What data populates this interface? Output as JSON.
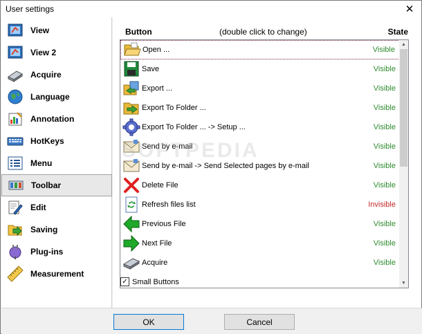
{
  "window": {
    "title": "User settings",
    "close_glyph": "✕"
  },
  "sidebar": {
    "items": [
      {
        "label": "View",
        "icon": "view-icon"
      },
      {
        "label": "View 2",
        "icon": "view2-icon"
      },
      {
        "label": "Acquire",
        "icon": "scanner-icon"
      },
      {
        "label": "Language",
        "icon": "globe-icon"
      },
      {
        "label": "Annotation",
        "icon": "annotation-icon"
      },
      {
        "label": "HotKeys",
        "icon": "keyboard-icon"
      },
      {
        "label": "Menu",
        "icon": "menu-icon"
      },
      {
        "label": "Toolbar",
        "icon": "toolbar-icon",
        "selected": true
      },
      {
        "label": "Edit",
        "icon": "edit-icon"
      },
      {
        "label": "Saving",
        "icon": "saving-icon"
      },
      {
        "label": "Plug-ins",
        "icon": "plugin-icon"
      },
      {
        "label": "Measurement",
        "icon": "ruler-icon"
      }
    ]
  },
  "toolbar_panel": {
    "header_button": "Button",
    "header_hint": "(double click to change)",
    "header_state": "State",
    "rows": [
      {
        "name": "Open ...",
        "state": "Visible",
        "icon": "open-folder-icon"
      },
      {
        "name": "Save",
        "state": "Visible",
        "icon": "save-icon"
      },
      {
        "name": "Export ...",
        "state": "Visible",
        "icon": "export-icon"
      },
      {
        "name": "Export To Folder ...",
        "state": "Visible",
        "icon": "export-folder-icon"
      },
      {
        "name": "Export To Folder ... -> Setup ...",
        "state": "Visible",
        "icon": "setup-gear-icon"
      },
      {
        "name": "Send by e-mail",
        "state": "Visible",
        "icon": "email-icon"
      },
      {
        "name": "Send by e-mail -> Send Selected pages by e-mail",
        "state": "Visible",
        "icon": "email-pages-icon"
      },
      {
        "name": "Delete File",
        "state": "Visible",
        "icon": "delete-icon"
      },
      {
        "name": "Refresh files list",
        "state": "Invisible",
        "icon": "refresh-icon"
      },
      {
        "name": "Previous File",
        "state": "Visible",
        "icon": "arrow-left-icon"
      },
      {
        "name": "Next File",
        "state": "Visible",
        "icon": "arrow-right-icon"
      },
      {
        "name": "Acquire",
        "state": "Visible",
        "icon": "scanner-icon"
      }
    ],
    "small_buttons_label": "Small Buttons",
    "small_buttons_checked": true
  },
  "footer": {
    "ok_label": "OK",
    "cancel_label": "Cancel"
  },
  "watermark": "SOFTPEDIA",
  "colors": {
    "visible": "#2e8b2e",
    "invisible": "#c62828",
    "focus_border": "#0078d7"
  }
}
